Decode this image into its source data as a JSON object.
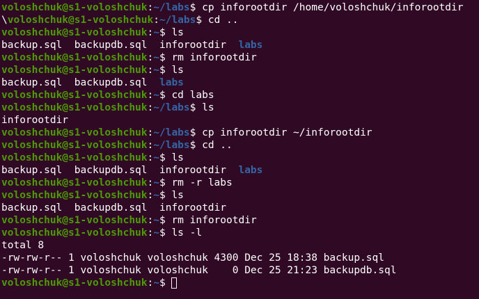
{
  "terminal": {
    "background_color": "#300a24",
    "user_color": "#4e9a06",
    "dir_color": "#3465a4",
    "text_color": "#ffffff",
    "lines": [
      {
        "type": "prompt",
        "prefix": "",
        "user": "voloshchuk@s1-voloshchuk",
        "path": "~/labs",
        "cmd": "cp inforootdir /home/voloshchuk/inforootdir"
      },
      {
        "type": "prompt",
        "prefix": "\\",
        "user": "voloshchuk@s1-voloshchuk",
        "path": "~/labs",
        "cmd": "cd .."
      },
      {
        "type": "prompt",
        "prefix": "",
        "user": "voloshchuk@s1-voloshchuk",
        "path": "~",
        "cmd": "ls"
      },
      {
        "type": "output",
        "segments": [
          {
            "text": "backup.sql  backupdb.sql  inforootdir  ",
            "dir": false
          },
          {
            "text": "labs",
            "dir": true
          }
        ]
      },
      {
        "type": "prompt",
        "prefix": "",
        "user": "voloshchuk@s1-voloshchuk",
        "path": "~",
        "cmd": "rm inforootdir"
      },
      {
        "type": "prompt",
        "prefix": "",
        "user": "voloshchuk@s1-voloshchuk",
        "path": "~",
        "cmd": "ls"
      },
      {
        "type": "output",
        "segments": [
          {
            "text": "backup.sql  backupdb.sql  ",
            "dir": false
          },
          {
            "text": "labs",
            "dir": true
          }
        ]
      },
      {
        "type": "prompt",
        "prefix": "",
        "user": "voloshchuk@s1-voloshchuk",
        "path": "~",
        "cmd": "cd labs"
      },
      {
        "type": "prompt",
        "prefix": "",
        "user": "voloshchuk@s1-voloshchuk",
        "path": "~/labs",
        "cmd": "ls"
      },
      {
        "type": "output",
        "segments": [
          {
            "text": "inforootdir",
            "dir": false
          }
        ]
      },
      {
        "type": "prompt",
        "prefix": "",
        "user": "voloshchuk@s1-voloshchuk",
        "path": "~/labs",
        "cmd": "cp inforootdir ~/inforootdir"
      },
      {
        "type": "prompt",
        "prefix": "",
        "user": "voloshchuk@s1-voloshchuk",
        "path": "~/labs",
        "cmd": "cd .."
      },
      {
        "type": "prompt",
        "prefix": "",
        "user": "voloshchuk@s1-voloshchuk",
        "path": "~",
        "cmd": "ls"
      },
      {
        "type": "output",
        "segments": [
          {
            "text": "backup.sql  backupdb.sql  inforootdir  ",
            "dir": false
          },
          {
            "text": "labs",
            "dir": true
          }
        ]
      },
      {
        "type": "prompt",
        "prefix": "",
        "user": "voloshchuk@s1-voloshchuk",
        "path": "~",
        "cmd": "rm -r labs"
      },
      {
        "type": "prompt",
        "prefix": "",
        "user": "voloshchuk@s1-voloshchuk",
        "path": "~",
        "cmd": "ls"
      },
      {
        "type": "output",
        "segments": [
          {
            "text": "backup.sql  backupdb.sql  inforootdir",
            "dir": false
          }
        ]
      },
      {
        "type": "prompt",
        "prefix": "",
        "user": "voloshchuk@s1-voloshchuk",
        "path": "~",
        "cmd": "rm inforootdir"
      },
      {
        "type": "prompt",
        "prefix": "",
        "user": "voloshchuk@s1-voloshchuk",
        "path": "~",
        "cmd": "ls -l"
      },
      {
        "type": "output",
        "segments": [
          {
            "text": "total 8",
            "dir": false
          }
        ]
      },
      {
        "type": "output",
        "segments": [
          {
            "text": "-rw-rw-r-- 1 voloshchuk voloshchuk 4300 Dec 25 18:38 backup.sql",
            "dir": false
          }
        ]
      },
      {
        "type": "output",
        "segments": [
          {
            "text": "-rw-rw-r-- 1 voloshchuk voloshchuk    0 Dec 25 21:23 backupdb.sql",
            "dir": false
          }
        ]
      },
      {
        "type": "current",
        "prefix": "",
        "user": "voloshchuk@s1-voloshchuk",
        "path": "~",
        "cmd": ""
      }
    ]
  }
}
